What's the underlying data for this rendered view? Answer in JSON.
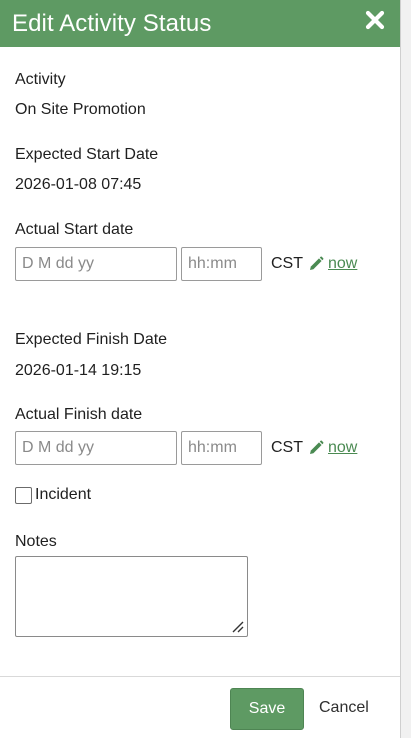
{
  "dialog": {
    "title": "Edit Activity Status",
    "close_icon": "close-icon"
  },
  "activity": {
    "label": "Activity",
    "value": "On Site Promotion"
  },
  "expected_start": {
    "label": "Expected Start Date",
    "value": "2026-01-08 07:45"
  },
  "actual_start": {
    "label": "Actual Start date",
    "date_placeholder": "D M dd yy",
    "date_value": "",
    "time_placeholder": "hh:mm",
    "time_value": "",
    "timezone": "CST",
    "edit_icon": "pencil-icon",
    "now_label": "now"
  },
  "expected_finish": {
    "label": "Expected Finish Date",
    "value": "2026-01-14 19:15"
  },
  "actual_finish": {
    "label": "Actual Finish date",
    "date_placeholder": "D M dd yy",
    "date_value": "",
    "time_placeholder": "hh:mm",
    "time_value": "",
    "timezone": "CST",
    "edit_icon": "pencil-icon",
    "now_label": "now"
  },
  "incident": {
    "label": "Incident",
    "checked": false
  },
  "notes": {
    "label": "Notes",
    "value": ""
  },
  "footer": {
    "save_label": "Save",
    "cancel_label": "Cancel"
  },
  "colors": {
    "accent": "#5e9a63",
    "link": "#4a8a52"
  }
}
